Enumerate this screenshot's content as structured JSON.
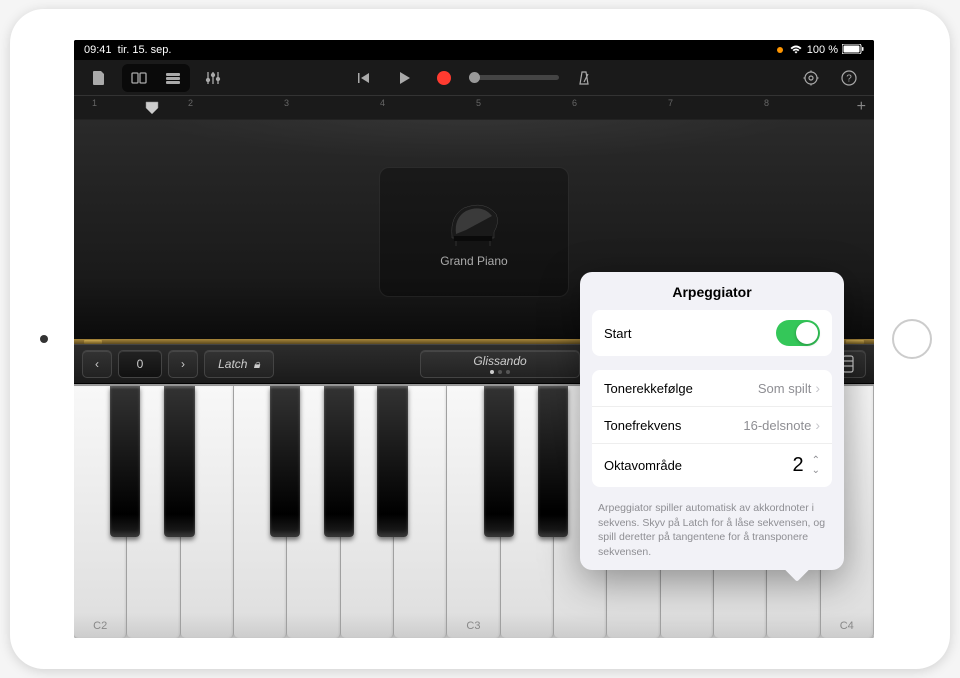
{
  "status": {
    "time": "09:41",
    "date": "tir. 15. sep.",
    "battery_pct": "100 %"
  },
  "ruler": {
    "marks": [
      "1",
      "2",
      "3",
      "4",
      "5",
      "6",
      "7",
      "8"
    ]
  },
  "instrument": {
    "name": "Grand Piano"
  },
  "controls": {
    "octave_value": "0",
    "latch_label": "Latch",
    "glissando_label": "Glissando"
  },
  "keyboard": {
    "c_labels": [
      "C2",
      "C3",
      "C4"
    ]
  },
  "popover": {
    "title": "Arpeggiator",
    "start_label": "Start",
    "order_label": "Tonerekkefølge",
    "order_value": "Som spilt",
    "rate_label": "Tonefrekvens",
    "rate_value": "16-delsnote",
    "range_label": "Oktavområde",
    "range_value": "2",
    "help": "Arpeggiator spiller automatisk av akkordnoter i sekvens. Skyv på Latch for å låse sekvensen, og spill deretter på tangentene for å transponere sekvensen."
  }
}
